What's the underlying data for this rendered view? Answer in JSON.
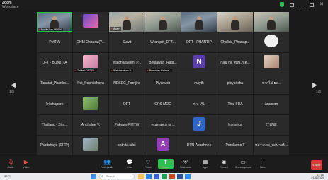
{
  "window": {
    "app_name": "Zoom",
    "title": "Workplace"
  },
  "navigation": {
    "prev_page": "1/3",
    "next_page": "1/3"
  },
  "participants": [
    {
      "name": "",
      "caption": "Mobile Lab NESDC",
      "kind": "video",
      "style": "v4",
      "active": true
    },
    {
      "name": "",
      "caption": "",
      "kind": "logo",
      "style": "logo-purple"
    },
    {
      "name": "",
      "caption": "สื่อสาร",
      "kind": "video",
      "style": "v2"
    },
    {
      "name": "",
      "caption": "",
      "kind": "video",
      "style": "v3"
    },
    {
      "name": "",
      "caption": "",
      "kind": "video",
      "style": "v4"
    },
    {
      "name": "",
      "caption": "",
      "kind": "video",
      "style": "v5"
    },
    {
      "name": "",
      "caption": "",
      "kind": "video",
      "style": "v3"
    },
    {
      "name": "PMTW",
      "caption": "",
      "kind": "text"
    },
    {
      "name": "OHM Obaura (Y...",
      "caption": "",
      "kind": "text"
    },
    {
      "name": "Suwit",
      "caption": "",
      "kind": "text"
    },
    {
      "name": "Wrangsit_DFT...",
      "caption": "",
      "kind": "text"
    },
    {
      "name": "DFT - PHANTIP",
      "caption": "",
      "kind": "text"
    },
    {
      "name": "Chalida_Phanap...",
      "caption": "",
      "kind": "text"
    },
    {
      "name": "",
      "caption": "",
      "kind": "badge",
      "style": "badge-blue"
    },
    {
      "name": "DFT - BUNTITA",
      "caption": "",
      "kind": "text"
    },
    {
      "name": "",
      "caption": "Thitilert DFT(Ps...",
      "kind": "pic",
      "style": "pic-pink"
    },
    {
      "name": "Watcharakorn_P...",
      "caption": "Watcharakorn P...",
      "kind": "text"
    },
    {
      "name": "Benjawan_Rata...",
      "caption": "Benjawan Ratana...",
      "kind": "text"
    },
    {
      "name": "",
      "caption": "",
      "kind": "letter",
      "letter": "N",
      "color": "#5b3fa8"
    },
    {
      "name": "กลุ่ม กต สพน.ภ.ต...",
      "caption": "",
      "kind": "text"
    },
    {
      "name": "",
      "caption": "",
      "kind": "pic",
      "style": "pic-face"
    },
    {
      "name": "Tanatat_Phanko...",
      "caption": "",
      "kind": "text"
    },
    {
      "name": "Pui_Paphitchaya",
      "caption": "",
      "kind": "text"
    },
    {
      "name": "NESDC_Pornjira",
      "caption": "",
      "kind": "text"
    },
    {
      "name": "Piyanuch",
      "caption": "",
      "kind": "text"
    },
    {
      "name": "mayth",
      "caption": "",
      "kind": "text"
    },
    {
      "name": "ploypitcha",
      "caption": "",
      "kind": "text"
    },
    {
      "name": "พวกไข่ ยง...",
      "caption": "",
      "kind": "text"
    },
    {
      "name": "kritchaporn",
      "caption": "",
      "kind": "text"
    },
    {
      "name": "",
      "caption": "",
      "kind": "pic",
      "style": "pic-green"
    },
    {
      "name": "DFT",
      "caption": "",
      "kind": "text"
    },
    {
      "name": "OPS MOC",
      "caption": "",
      "kind": "text"
    },
    {
      "name": "กค. IAL",
      "caption": "",
      "kind": "text"
    },
    {
      "name": "Thai FDA",
      "caption": "",
      "kind": "text"
    },
    {
      "name": "Anusorn",
      "caption": "",
      "kind": "text"
    },
    {
      "name": "Thailand - Sira...",
      "caption": "",
      "kind": "text"
    },
    {
      "name": "Anchalee V.",
      "caption": "",
      "kind": "text"
    },
    {
      "name": "Pakwan-PMTW",
      "caption": "",
      "kind": "text"
    },
    {
      "name": "คณะ ผศ.ยาง ...",
      "caption": "",
      "kind": "text"
    },
    {
      "name": "",
      "caption": "",
      "kind": "letter",
      "letter": "J",
      "color": "#2f67c9"
    },
    {
      "name": "Koravica",
      "caption": "",
      "kind": "text"
    },
    {
      "name": "江妮娜",
      "caption": "",
      "kind": "text"
    },
    {
      "name": "Papitchaya (DITP)",
      "caption": "",
      "kind": "text"
    },
    {
      "name": "",
      "caption": "",
      "kind": "pic",
      "style": "pic-scene"
    },
    {
      "name": "sathita.taks",
      "caption": "",
      "kind": "text"
    },
    {
      "name": "",
      "caption": "",
      "kind": "letter",
      "letter": "A",
      "color": "#8e3fb5"
    },
    {
      "name": "DTN-Apachnee",
      "caption": "",
      "kind": "text"
    },
    {
      "name": "PornkamolT",
      "caption": "",
      "kind": "text"
    },
    {
      "name": "หลาวาลย_พลบาทร์...",
      "caption": "",
      "kind": "text"
    }
  ],
  "toolbar": {
    "items": [
      {
        "id": "audio",
        "label": "Audio",
        "icon": "mic-off-icon",
        "glyph": "🎙",
        "red": true
      },
      {
        "id": "video",
        "label": "Video",
        "icon": "camera-off-icon",
        "glyph": "▶",
        "red": true
      },
      {
        "id": "participants",
        "label": "Participants",
        "icon": "people-icon",
        "glyph": "👥"
      },
      {
        "id": "chat",
        "label": "Chat",
        "icon": "chat-icon",
        "glyph": "💬"
      },
      {
        "id": "react",
        "label": "React",
        "icon": "heart-icon",
        "glyph": "♡"
      },
      {
        "id": "share",
        "label": "Share",
        "icon": "share-icon",
        "glyph": "⬆",
        "share": true
      },
      {
        "id": "host_tools",
        "label": "Host tools",
        "icon": "shield-icon",
        "glyph": "⛨"
      },
      {
        "id": "apps",
        "label": "Apps",
        "icon": "apps-icon",
        "glyph": "▦"
      },
      {
        "id": "record",
        "label": "Record",
        "icon": "record-icon",
        "glyph": "◉"
      },
      {
        "id": "show_captions",
        "label": "Show captions",
        "icon": "captions-icon",
        "glyph": "▭"
      },
      {
        "id": "more",
        "label": "More",
        "icon": "more-icon",
        "glyph": "⋯"
      }
    ],
    "leave_label": "Leave"
  },
  "taskbar": {
    "weather": "33°C",
    "search_placeholder": "Search",
    "time": "11:16",
    "date": "21/6/2024"
  },
  "colors": {
    "background": "#1a1a1a",
    "tile": "#2a2a2a",
    "active_speaker": "#2fbf4e",
    "leave": "#d63b3b"
  }
}
